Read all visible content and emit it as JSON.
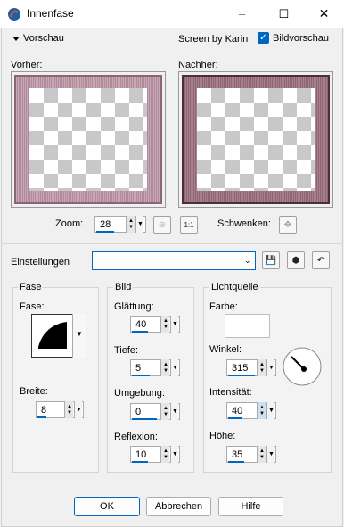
{
  "window": {
    "title": "Innenfase",
    "minimize_glyph": "–",
    "maximize_glyph": "☐",
    "close_glyph": "✕"
  },
  "toolbar": {
    "vorschau_label": "Vorschau",
    "screen_by": "Screen by Karin",
    "bildvorschau_label": "Bildvorschau",
    "bildvorschau_checked": true
  },
  "preview": {
    "before_label": "Vorher:",
    "after_label": "Nachher:"
  },
  "zoom": {
    "label": "Zoom:",
    "value": "28",
    "pan_label": "Schwenken:"
  },
  "settings": {
    "label": "Einstellungen",
    "value": ""
  },
  "fase": {
    "title": "Fase",
    "bevel_label": "Fase:",
    "width_label": "Breite:",
    "width_value": "8"
  },
  "bild": {
    "title": "Bild",
    "smoothness_label": "Glättung:",
    "smoothness_value": "40",
    "depth_label": "Tiefe:",
    "depth_value": "5",
    "ambience_label": "Umgebung:",
    "ambience_value": "0",
    "reflection_label": "Reflexion:",
    "reflection_value": "10"
  },
  "light": {
    "title": "Lichtquelle",
    "color_label": "Farbe:",
    "color_value": "#ffffff",
    "angle_label": "Winkel:",
    "angle_value": "315",
    "intensity_label": "Intensität:",
    "intensity_value": "40",
    "elevation_label": "Höhe:",
    "elevation_value": "35"
  },
  "buttons": {
    "ok": "OK",
    "cancel": "Abbrechen",
    "help": "Hilfe"
  },
  "colors": {
    "accent": "#0067c0",
    "frame": "#b08a9a"
  }
}
